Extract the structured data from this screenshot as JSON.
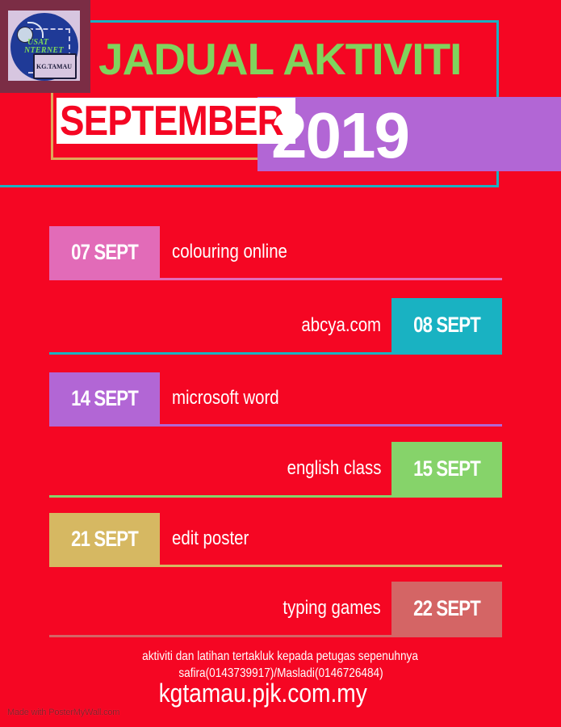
{
  "logo": {
    "line1": "USAT",
    "line2": "NTERNET",
    "laptop_label": "KG.TAMAU"
  },
  "header": {
    "title": "JADUAL AKTIVITI",
    "month": "SEPTEMBER",
    "year": "2019"
  },
  "colors": {
    "background": "#f50623",
    "title_green": "#80d35d",
    "frame_teal": "#1ab1c2",
    "frame_gold": "#e0a85a",
    "year_purple": "#b266d5"
  },
  "schedule": [
    {
      "date": "07 SEPT",
      "activity": "colouring online",
      "side": "left",
      "color": "#e26bb8"
    },
    {
      "date": "08 SEPT",
      "activity": "abcya.com",
      "side": "right",
      "color": "#19b2c2"
    },
    {
      "date": "14 SEPT",
      "activity": "microsoft word",
      "side": "left",
      "color": "#b266d5"
    },
    {
      "date": "15 SEPT",
      "activity": "english class",
      "side": "right",
      "color": "#86d36a"
    },
    {
      "date": "21 SEPT",
      "activity": "edit poster",
      "side": "left",
      "color": "#d6b862"
    },
    {
      "date": "22 SEPT",
      "activity": "typing games",
      "side": "right",
      "color": "#d46565"
    }
  ],
  "footer": {
    "note": "aktiviti dan latihan tertakluk kepada petugas sepenuhnya",
    "contacts": "safira(0143739917)/Masladi(0146726484)",
    "url": "kgtamau.pjk.com.my",
    "watermark": "Made with PosterMyWall.com"
  }
}
